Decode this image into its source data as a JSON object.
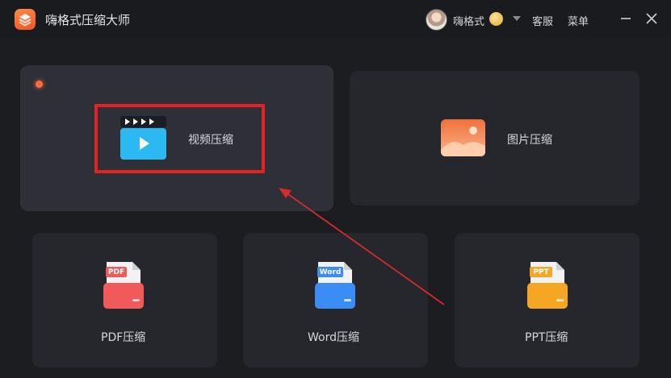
{
  "app": {
    "title": "嗨格式压缩大师"
  },
  "header": {
    "username": "嗨格式",
    "service_label": "客服",
    "menu_label": "菜单"
  },
  "cards": {
    "video": {
      "label": "视频压缩"
    },
    "image": {
      "label": "图片压缩"
    },
    "pdf": {
      "label": "PDF压缩",
      "badge": "PDF"
    },
    "word": {
      "label": "Word压缩",
      "badge": "Word"
    },
    "ppt": {
      "label": "PPT压缩",
      "badge": "PPT"
    }
  },
  "colors": {
    "accent": "#ff6a3a",
    "highlight": "#e52222",
    "video": "#2cb8f0",
    "pdf": "#f05a5a",
    "word": "#3c8cf5",
    "ppt": "#f5a623"
  },
  "icons": {
    "app": "app-logo-icon",
    "vip": "vip-badge-icon",
    "dropdown": "chevron-down-icon",
    "minimize": "minimize-icon",
    "close": "close-icon"
  }
}
